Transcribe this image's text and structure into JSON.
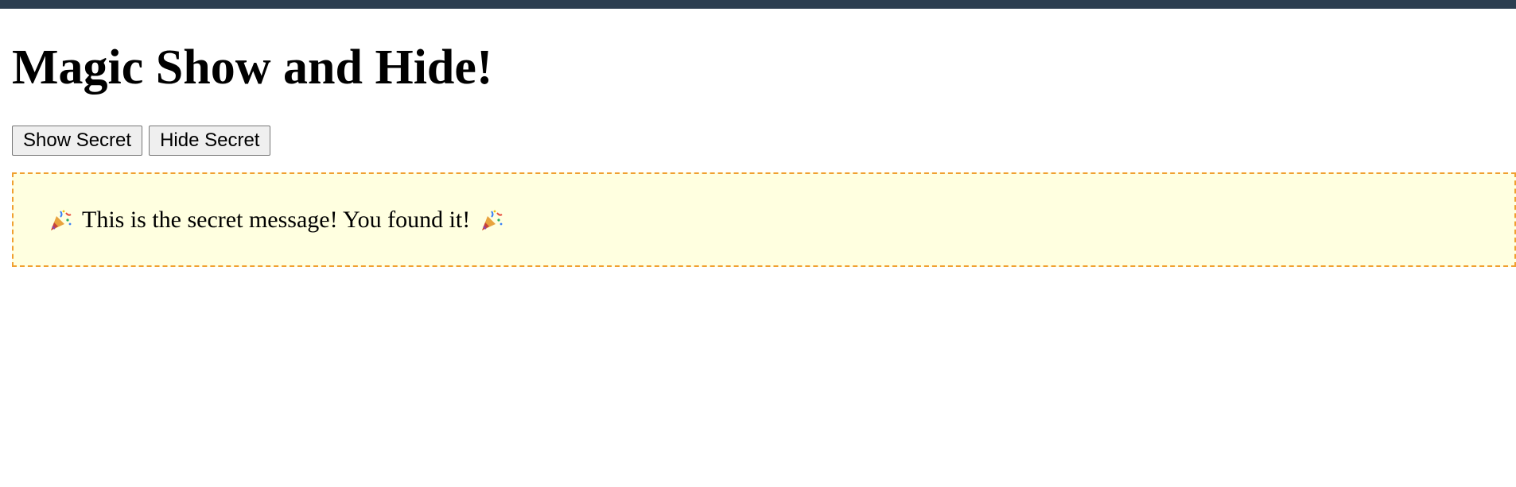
{
  "page": {
    "title": "Magic Show and Hide!"
  },
  "buttons": {
    "show_label": "Show Secret",
    "hide_label": "Hide Secret"
  },
  "secret": {
    "message": "This is the secret message! You found it!",
    "icon": "party-popper-icon"
  },
  "colors": {
    "top_bar": "#2c3e50",
    "secret_border": "#f0a030",
    "secret_background": "#ffffe0"
  }
}
